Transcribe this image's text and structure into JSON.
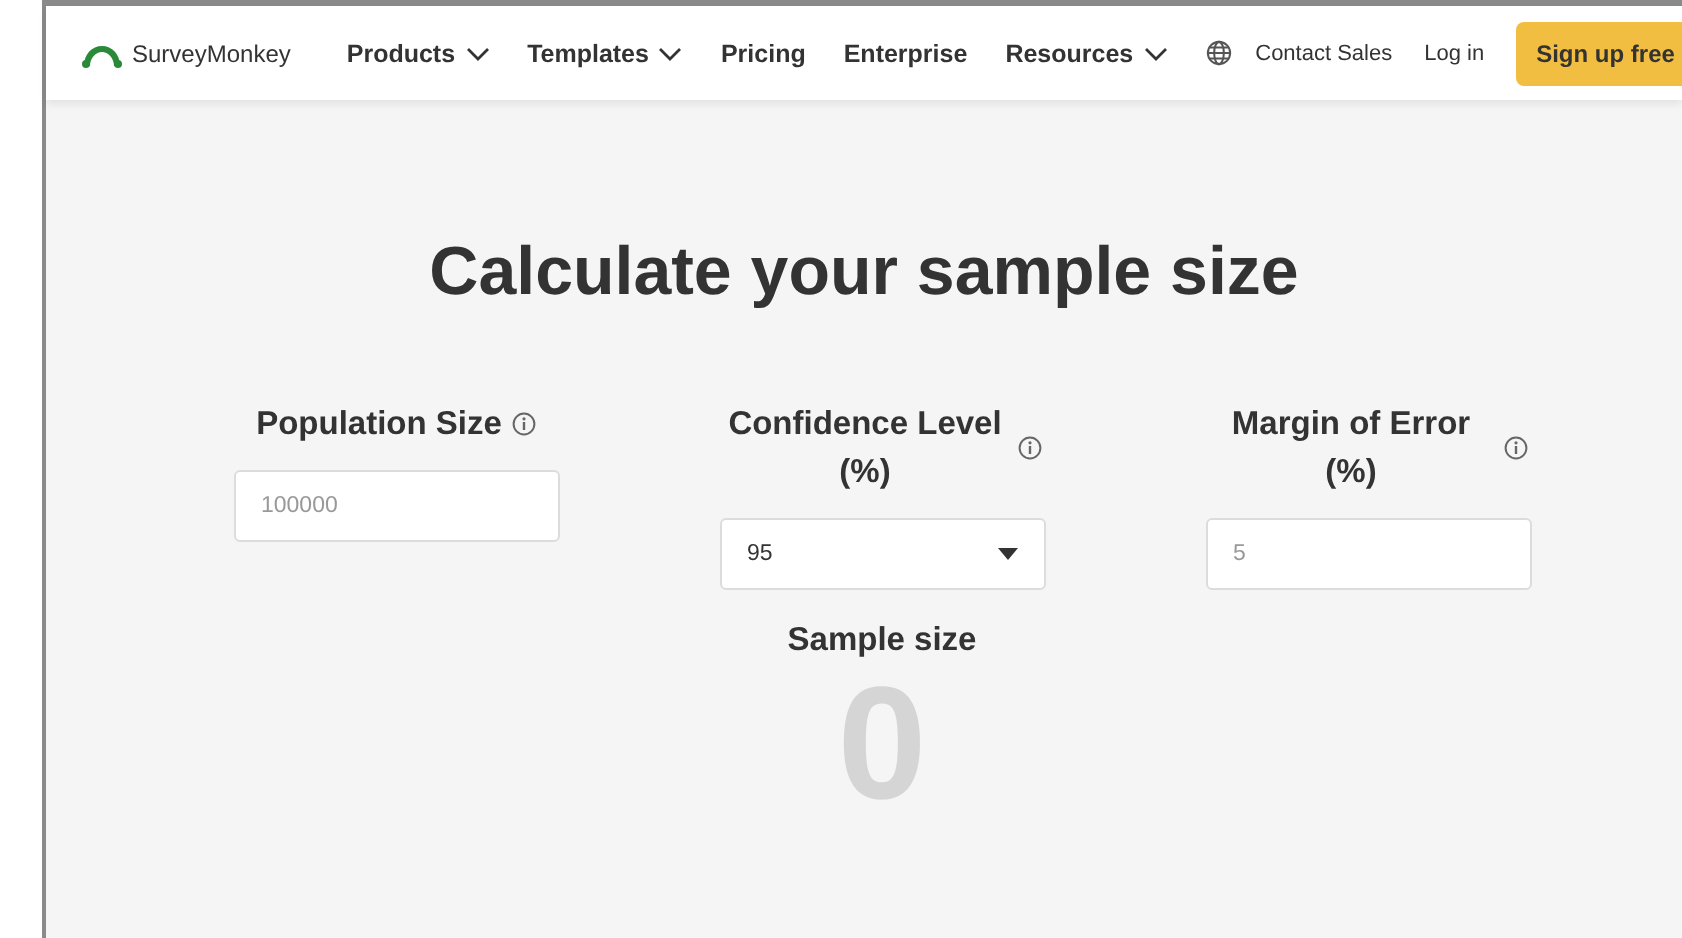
{
  "header": {
    "logo": "SurveyMonkey",
    "nav": [
      {
        "label": "Products",
        "dropdown": true
      },
      {
        "label": "Templates",
        "dropdown": true
      },
      {
        "label": "Pricing",
        "dropdown": false
      },
      {
        "label": "Enterprise",
        "dropdown": false
      },
      {
        "label": "Resources",
        "dropdown": true
      }
    ],
    "links": [
      "Contact Sales",
      "Log in"
    ],
    "cta": "Sign up free"
  },
  "title": "Calculate your sample size",
  "fields": [
    {
      "kind": "input",
      "label": "Population Size",
      "placeholder": "100000"
    },
    {
      "kind": "select",
      "label": "Confidence Level (%)",
      "value": "95"
    },
    {
      "kind": "input",
      "label": "Margin of Error (%)",
      "placeholder": "5"
    }
  ],
  "result": {
    "label": "Sample size",
    "value": "0"
  }
}
